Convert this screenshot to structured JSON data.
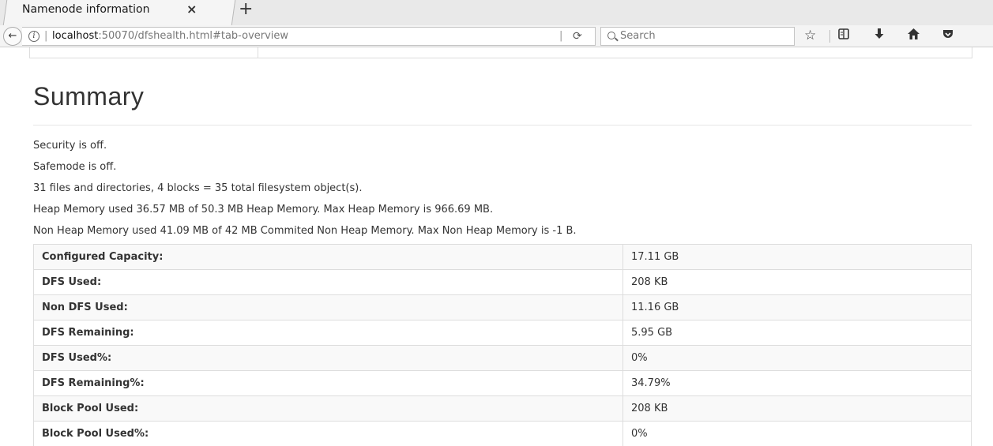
{
  "browser": {
    "tab_title": "Namenode information",
    "tab_close": "×",
    "new_tab": "+",
    "back": "←",
    "info": "i",
    "url_host": "localhost",
    "url_rest": ":50070/dfshealth.html#tab-overview",
    "reload": "⟳",
    "search_placeholder": "Search",
    "toolbar_icons": [
      "star-icon",
      "reading-list-icon",
      "download-icon",
      "home-icon",
      "pocket-icon"
    ]
  },
  "summary": {
    "title": "Summary",
    "lines": [
      "Security is off.",
      "Safemode is off.",
      "31 files and directories, 4 blocks = 35 total filesystem object(s).",
      "Heap Memory used 36.57 MB of 50.3 MB Heap Memory. Max Heap Memory is 966.69 MB.",
      "Non Heap Memory used 41.09 MB of 42 MB Commited Non Heap Memory. Max Non Heap Memory is -1 B."
    ],
    "table": [
      {
        "label": "Configured Capacity:",
        "value": "17.11 GB"
      },
      {
        "label": "DFS Used:",
        "value": "208 KB"
      },
      {
        "label": "Non DFS Used:",
        "value": "11.16 GB"
      },
      {
        "label": "DFS Remaining:",
        "value": "5.95 GB"
      },
      {
        "label": "DFS Used%:",
        "value": "0%"
      },
      {
        "label": "DFS Remaining%:",
        "value": "34.79%"
      },
      {
        "label": "Block Pool Used:",
        "value": "208 KB"
      },
      {
        "label": "Block Pool Used%:",
        "value": "0%"
      }
    ]
  }
}
